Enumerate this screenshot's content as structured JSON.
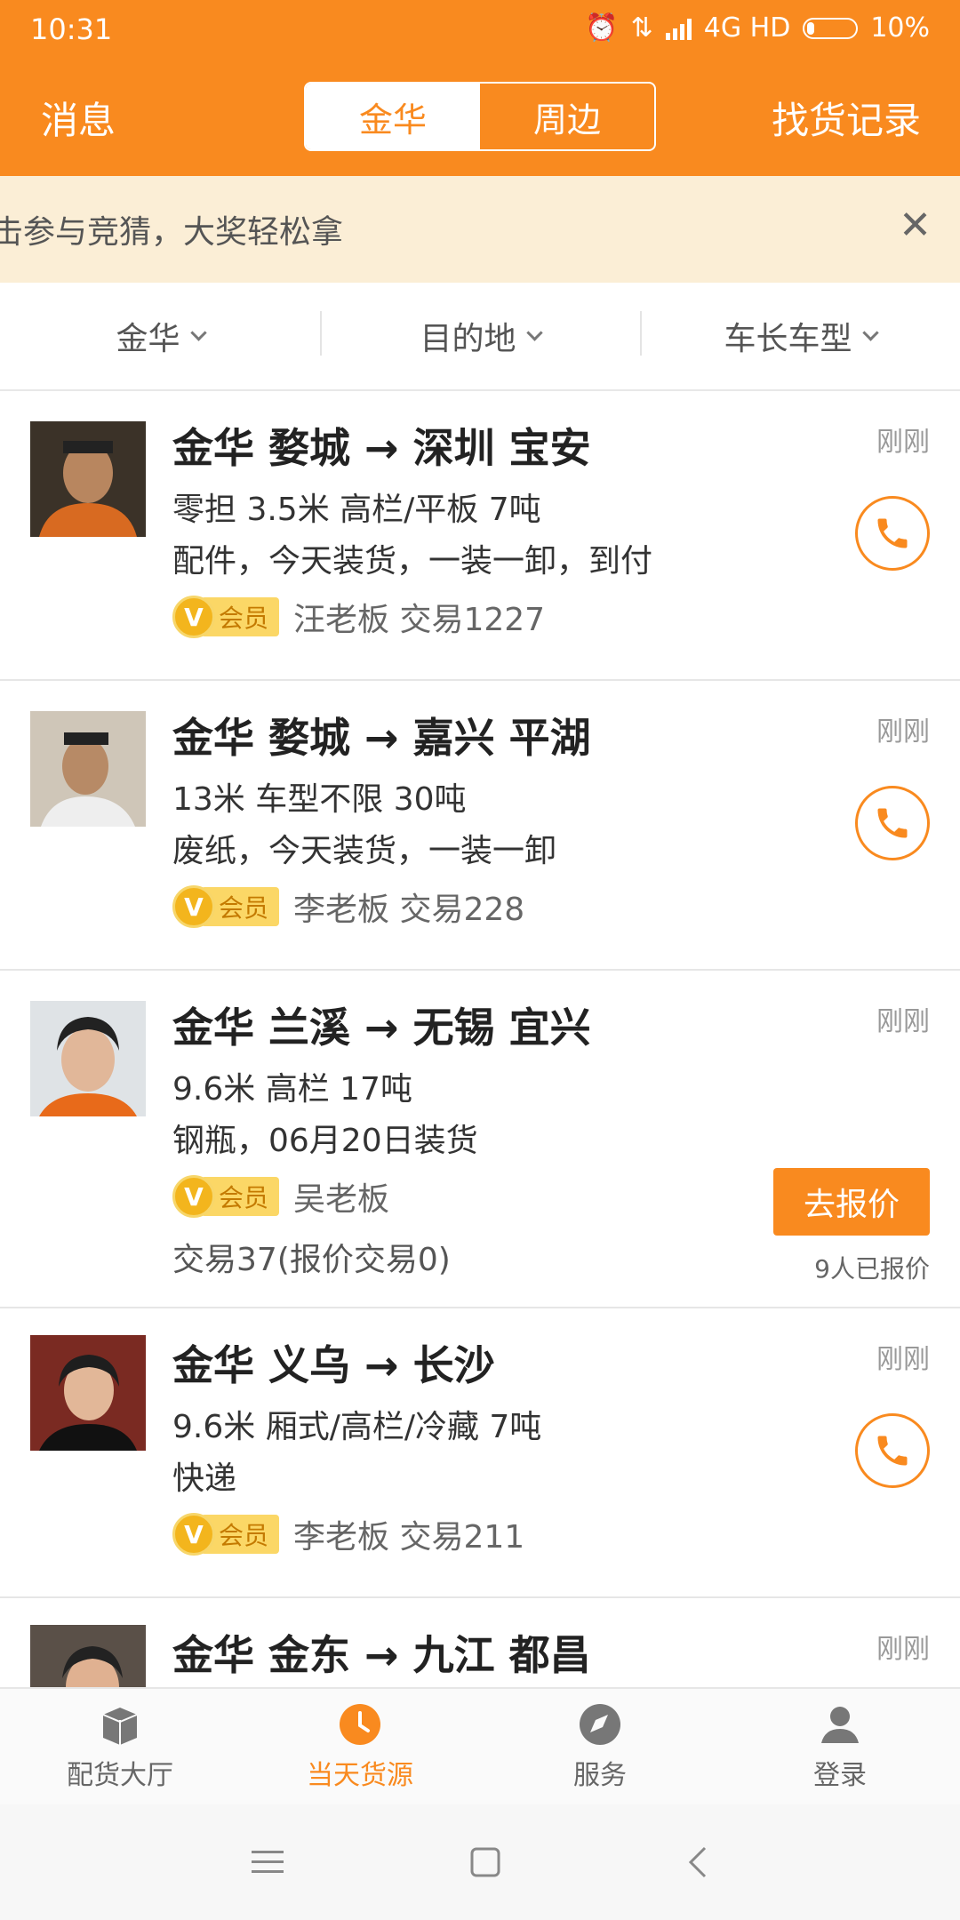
{
  "status_bar": {
    "time": "10:31",
    "network": "4G HD",
    "battery": "10%"
  },
  "header": {
    "left": "消息",
    "right": "找货记录",
    "tabs": [
      "金华",
      "周边"
    ]
  },
  "notice": {
    "text": "击参与竞猜，大奖轻松拿"
  },
  "filters": [
    "金华",
    "目的地",
    "车长车型"
  ],
  "cards": [
    {
      "route": "金华 婺城 → 深圳 宝安",
      "spec": "零担 3.5米 高栏/平板 7吨",
      "detail": "配件，今天装货，一装一卸，到付",
      "vip": "会员",
      "owner": "汪老板  交易1227",
      "time": "刚刚"
    },
    {
      "route": "金华 婺城 → 嘉兴 平湖",
      "spec": "13米 车型不限 30吨",
      "detail": "废纸，今天装货，一装一卸",
      "vip": "会员",
      "owner": "李老板  交易228",
      "time": "刚刚"
    },
    {
      "route": "金华 兰溪 → 无锡 宜兴",
      "spec": "9.6米 高栏 17吨",
      "detail": "钢瓶，06月20日装货",
      "vip": "会员",
      "owner": "吴老板",
      "trades": "交易37(报价交易0)",
      "time": "刚刚",
      "quote_button": "去报价",
      "quoted_count": "9人已报价"
    },
    {
      "route": "金华 义乌 → 长沙",
      "spec": "9.6米 厢式/高栏/冷藏 7吨",
      "detail": "快递",
      "vip": "会员",
      "owner": "李老板  交易211",
      "time": "刚刚"
    },
    {
      "route": "金华 金东 → 九江 都昌",
      "time": "刚刚"
    }
  ],
  "tabbar": [
    "配货大厅",
    "当天货源",
    "服务",
    "登录"
  ],
  "colors": {
    "accent": "#f98a1f",
    "notice_bg": "#fbeed6"
  }
}
